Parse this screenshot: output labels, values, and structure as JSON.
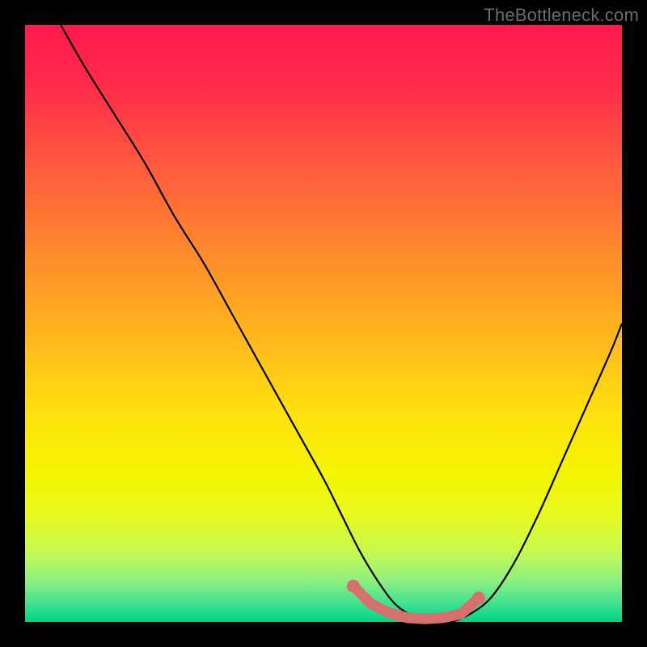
{
  "watermark": "TheBottleneck.com",
  "colors": {
    "curve": "#000000",
    "marker_stroke": "#d6706e",
    "marker_fill": "#d6706e"
  },
  "chart_data": {
    "type": "line",
    "title": "",
    "xlabel": "",
    "ylabel": "",
    "xlim": [
      0,
      100
    ],
    "ylim": [
      0,
      100
    ],
    "grid": false,
    "annotations": [],
    "series": [
      {
        "name": "bottleneck-curve",
        "x": [
          6,
          10,
          15,
          20,
          25,
          30,
          35,
          40,
          45,
          50,
          53,
          56,
          59,
          62,
          65,
          68,
          71,
          74,
          78,
          82,
          86,
          90,
          94,
          98,
          100
        ],
        "y": [
          100,
          93,
          85,
          77,
          68,
          60,
          51,
          42,
          33,
          24,
          18,
          12,
          7,
          3,
          1,
          0,
          0,
          1,
          4,
          10,
          18,
          27,
          36,
          45,
          50
        ]
      }
    ],
    "markers": {
      "name": "flat-region",
      "x": [
        55,
        58,
        61,
        64,
        67,
        70,
        73,
        76
      ],
      "y": [
        6,
        3,
        1.5,
        0.7,
        0.5,
        0.7,
        1.3,
        4
      ]
    }
  }
}
